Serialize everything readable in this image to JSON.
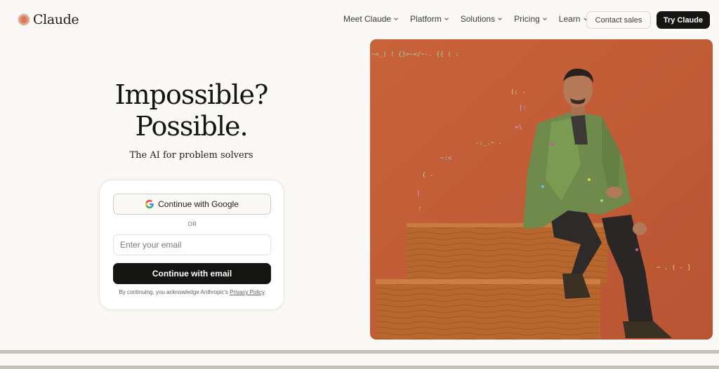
{
  "brand": {
    "name": "Claude",
    "accent": "#d97757"
  },
  "nav": {
    "items": [
      {
        "label": "Meet Claude"
      },
      {
        "label": "Platform"
      },
      {
        "label": "Solutions"
      },
      {
        "label": "Pricing"
      },
      {
        "label": "Learn"
      }
    ],
    "contact_label": "Contact sales",
    "try_label": "Try Claude"
  },
  "hero": {
    "headline_line1": "Impossible?",
    "headline_line2": "Possible.",
    "subhead": "The AI for problem solvers"
  },
  "login": {
    "google_label": "Continue with Google",
    "or_label": "OR",
    "email_placeholder": "Enter your email",
    "email_button_label": "Continue with email",
    "legal_prefix": "By continuing, you acknowledge Anthropic's",
    "legal_link": "Privacy Policy",
    "legal_suffix": "."
  },
  "colors": {
    "background": "#faf9f5",
    "dark_button": "#141413",
    "hero_orange": "#c4613c"
  }
}
